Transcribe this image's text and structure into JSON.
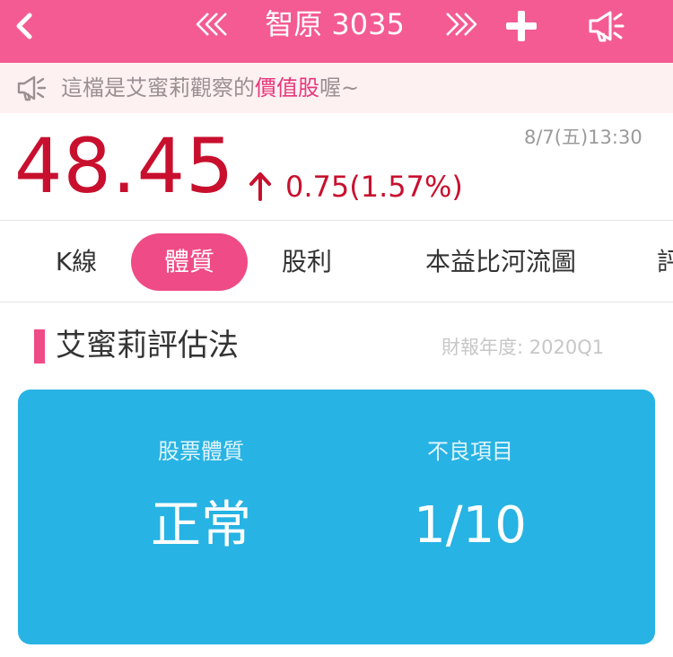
{
  "header": {
    "title": "智原 3035",
    "icons": {
      "back": "chevron-left-icon",
      "prev": "double-chevron-left-icon",
      "next": "double-chevron-right-icon",
      "add": "plus-icon",
      "speaker": "megaphone-icon"
    },
    "color": "#f45b93"
  },
  "notice": {
    "text_before": "這檔是艾蜜莉觀察的",
    "highlight": "價值股",
    "text_after": "喔~",
    "highlight_color": "#e8367c"
  },
  "quote": {
    "price": "48.45",
    "change": "0.75(1.57%)",
    "direction": "up",
    "time": "8/7(五)13:30",
    "color": "#c8102e"
  },
  "tabs": [
    {
      "label": "K線",
      "active": false
    },
    {
      "label": "體質",
      "active": true
    },
    {
      "label": "股利",
      "active": false
    },
    {
      "label": "本益比河流圖",
      "active": false
    },
    {
      "label": "評",
      "active": false
    }
  ],
  "section": {
    "title": "艾蜜莉評估法",
    "report_date": "財報年度: 2020Q1"
  },
  "card": {
    "color": "#27b3e4",
    "health_label": "股票體質",
    "health_value": "正常",
    "bad_items_label": "不良項目",
    "bad_items_value": "1/10"
  }
}
